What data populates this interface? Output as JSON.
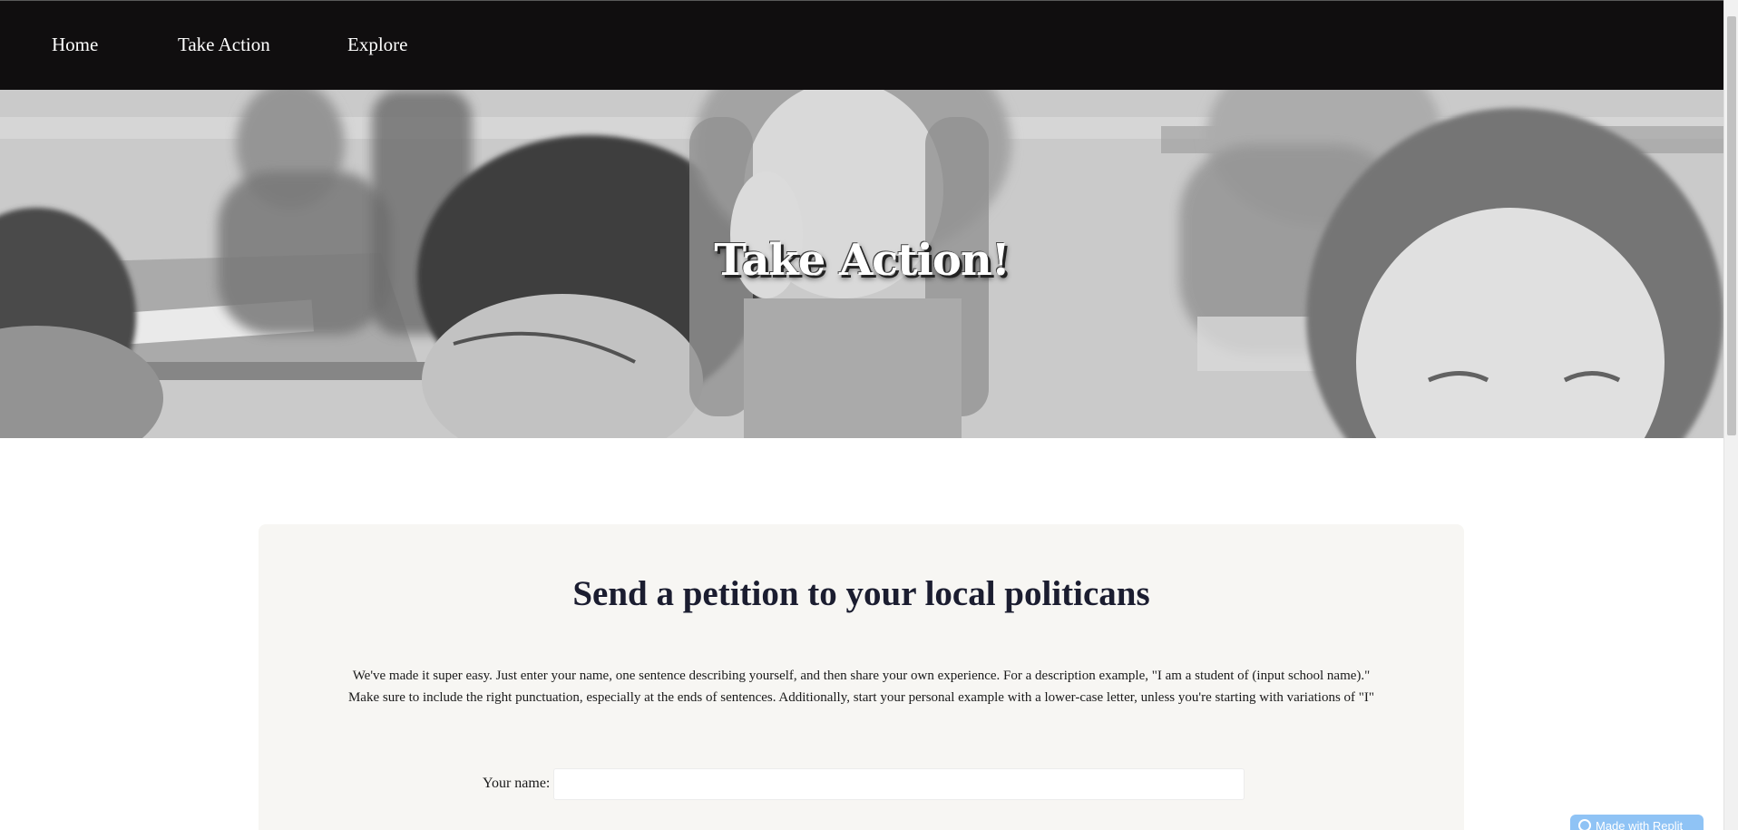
{
  "nav": {
    "items": [
      {
        "label": "Home"
      },
      {
        "label": "Take Action"
      },
      {
        "label": "Explore"
      }
    ]
  },
  "hero": {
    "title": "Take Action!"
  },
  "petition": {
    "title": "Send a petition to your local politicans",
    "description": "We've made it super easy. Just enter your name, one sentence describing yourself, and then share your own experience. For a description example, \"I am a student of (input school name).\" Make sure to include the right punctuation, especially at the ends of sentences. Additionally, start your personal example with a lower-case letter, unless you're starting with variations of \"I\"",
    "name_label": "Your name:",
    "name_value": ""
  },
  "badge": {
    "label": "Made with Replit",
    "icon": "replit-icon"
  },
  "colors": {
    "nav_bg": "#100e0f",
    "card_bg": "#f7f6f3",
    "title_color": "#1b1d30",
    "badge_bg": "#8fc3f5"
  }
}
